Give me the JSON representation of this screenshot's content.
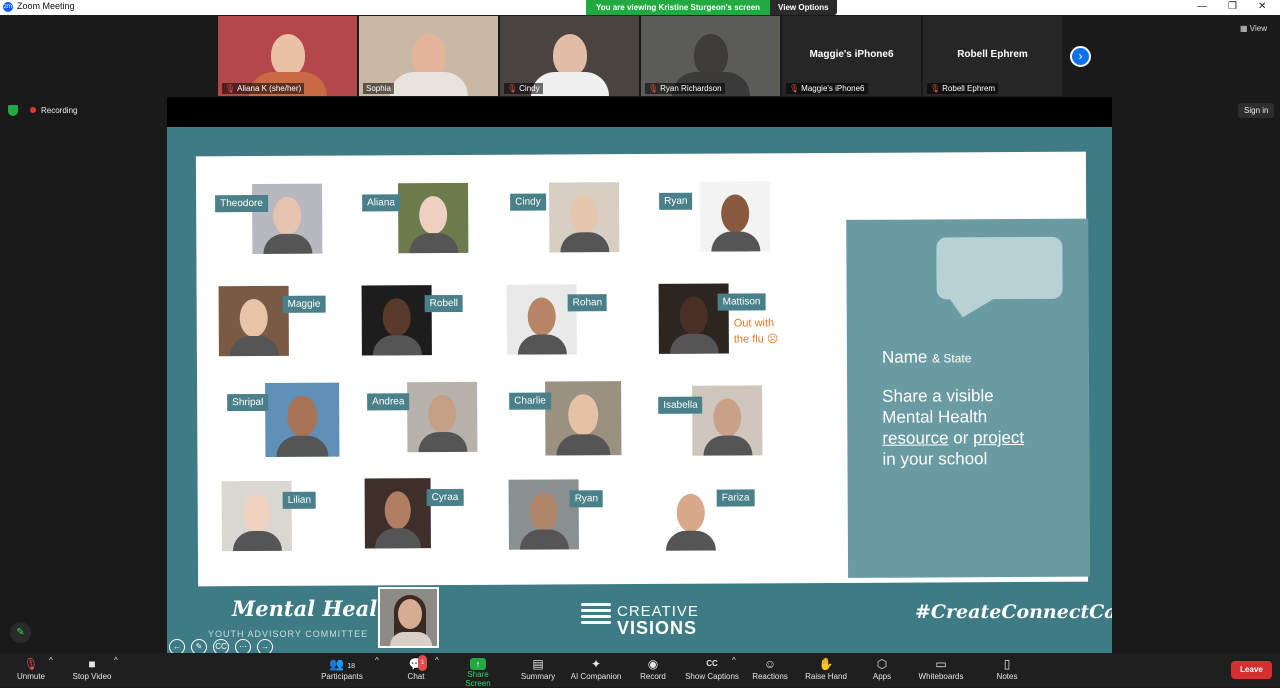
{
  "window": {
    "title": "Zoom Meeting",
    "app_logo": "zm",
    "controls": [
      "—",
      "❐",
      "✕"
    ]
  },
  "banner": {
    "message": "You are viewing Kristine Sturgeon's screen",
    "view_options": "View Options"
  },
  "gallery": {
    "tiles": [
      {
        "name": "Aliana K (she/her)",
        "muted": true,
        "video": true,
        "bg": "#b3474a",
        "skin": "#e7c0a6",
        "shirt": "#c96a45"
      },
      {
        "name": "Sophia",
        "muted": false,
        "video": true,
        "active": true,
        "bg": "#c9b9a4",
        "skin": "#e3b49a",
        "shirt": "#e8e3dd"
      },
      {
        "name": "Cindy",
        "muted": true,
        "video": true,
        "bg": "#4b4340",
        "skin": "#e2bca4",
        "shirt": "#f0f0f0"
      },
      {
        "name": "Ryan Richardson",
        "muted": true,
        "video": true,
        "bg": "#5b5b58",
        "skin": "#3e3b39",
        "shirt": "#3a3a3a"
      },
      {
        "name": "Maggie's iPhone6",
        "muted": true,
        "video": false,
        "big": "Maggie's iPhone6"
      },
      {
        "name": "Robell Ephrem",
        "muted": true,
        "video": false,
        "big": "Robell Ephrem"
      }
    ],
    "next_icon": "›",
    "view_label": "View"
  },
  "meeting": {
    "recording_label": "Recording",
    "sign_in": "Sign in"
  },
  "slide": {
    "people": [
      {
        "name": "Theodore",
        "photo": "#b8b8c0"
      },
      {
        "name": "Aliana",
        "photo": "#6d7a4c"
      },
      {
        "name": "Cindy",
        "photo": "#d7cfc4"
      },
      {
        "name": "Ryan",
        "photo": "#f3f3f3"
      },
      {
        "name": "Maggie",
        "photo": "#7a5a44"
      },
      {
        "name": "Robell",
        "photo": "#1d1d1d"
      },
      {
        "name": "Rohan",
        "photo": "#e9e9e9"
      },
      {
        "name": "Mattison",
        "photo": "#2d2520"
      },
      {
        "name": "Shripal",
        "photo": "#5e90b8"
      },
      {
        "name": "Andrea",
        "photo": "#b7b2ac"
      },
      {
        "name": "Charlie",
        "photo": "#9b9180"
      },
      {
        "name": "Isabella",
        "photo": "#cfc7bd"
      },
      {
        "name": "Lilian",
        "photo": "#dad6d2"
      },
      {
        "name": "Cyraa",
        "photo": "#3f2f2b"
      },
      {
        "name": "Ryan",
        "photo": "#8a8f92"
      },
      {
        "name": "Fariza",
        "photo": "#ffffff"
      }
    ],
    "flu_note_line1": "Out with",
    "flu_note_line2": "the flu ☹",
    "callout": {
      "name": "Name",
      "state": "& State",
      "line1": "Share a visible",
      "line2": "Mental Health",
      "resource": "resource",
      "or": "or",
      "project": "project",
      "line4": "in your school"
    },
    "footer": {
      "mental_health": "Mental Health",
      "committee": "YOUTH ADVISORY COMMITTEE",
      "cv_line1": "CREATIVE",
      "cv_line2": "VISIONS",
      "hashtag": "#CreateConnectCare"
    },
    "nav_icons": [
      "←",
      "✎",
      "CC",
      "⋯",
      "→"
    ]
  },
  "toolbar": {
    "items": [
      {
        "label": "Unmute",
        "icon": "microphone-muted-icon",
        "glyph": "🎙"
      },
      {
        "label": "Stop Video",
        "icon": "video-camera-icon",
        "glyph": "■"
      },
      {
        "label": "Participants",
        "icon": "participants-icon",
        "glyph": "👥",
        "count": "18"
      },
      {
        "label": "Chat",
        "icon": "chat-icon",
        "glyph": "💬",
        "badge": "1"
      },
      {
        "label": "Share Screen",
        "icon": "share-screen-icon",
        "glyph": "↑"
      },
      {
        "label": "Summary",
        "icon": "summary-icon",
        "glyph": "▤"
      },
      {
        "label": "AI Companion",
        "icon": "ai-companion-icon",
        "glyph": "✦"
      },
      {
        "label": "Record",
        "icon": "record-icon",
        "glyph": "◉"
      },
      {
        "label": "Show Captions",
        "icon": "captions-icon",
        "glyph": "CC"
      },
      {
        "label": "Reactions",
        "icon": "reactions-icon",
        "glyph": "☺"
      },
      {
        "label": "Raise Hand",
        "icon": "raise-hand-icon",
        "glyph": "✋"
      },
      {
        "label": "Apps",
        "icon": "apps-icon",
        "glyph": "⬡"
      },
      {
        "label": "Whiteboards",
        "icon": "whiteboard-icon",
        "glyph": "▭"
      },
      {
        "label": "Notes",
        "icon": "notes-icon",
        "glyph": "▯"
      }
    ],
    "leave": "Leave"
  },
  "colors": {
    "slide_teal": "#3e7b84",
    "tag_teal": "#4a8089",
    "zoom_blue": "#0b5cff",
    "share_green": "#23a942",
    "leave_red": "#d62f2f",
    "note_orange": "#e67a28"
  }
}
